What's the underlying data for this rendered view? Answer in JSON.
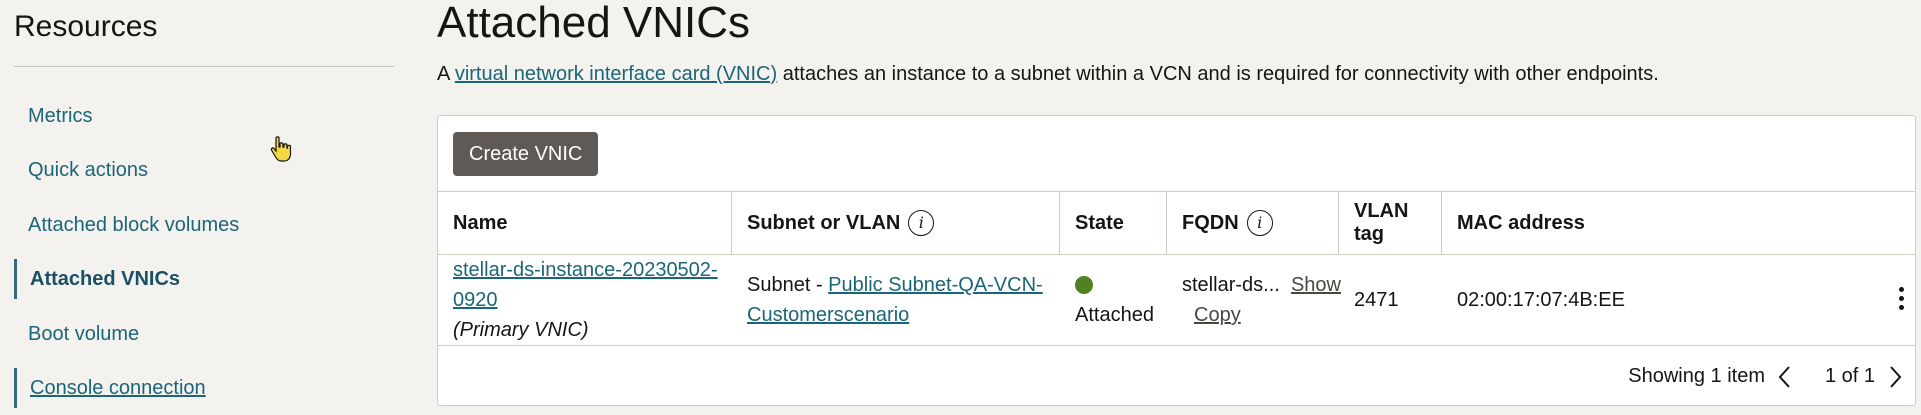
{
  "sidebar": {
    "title": "Resources",
    "items": [
      {
        "label": "Metrics"
      },
      {
        "label": "Quick actions"
      },
      {
        "label": "Attached block volumes"
      },
      {
        "label": "Attached VNICs"
      },
      {
        "label": "Boot volume"
      },
      {
        "label": "Console connection"
      }
    ]
  },
  "main": {
    "title": "Attached VNICs",
    "desc_prefix": "A",
    "desc_link": "virtual network interface card (VNIC)",
    "desc_suffix": "attaches an instance to a subnet within a VCN and is required for connectivity with other endpoints."
  },
  "table": {
    "create_button": "Create VNIC",
    "columns": [
      "Name",
      "Subnet or VLAN",
      "State",
      "FQDN",
      "VLAN tag",
      "MAC address"
    ],
    "rows": [
      {
        "name": "stellar-ds-instance-20230502-0920",
        "name_note": "(Primary VNIC)",
        "subnet_prefix": "Subnet -",
        "subnet_link_1": "Public Subnet-QA-VCN-",
        "subnet_link_2": "Customerscenario",
        "state": "Attached",
        "state_color": "#508223",
        "fqdn": "stellar-ds...",
        "fqdn_show": "Show",
        "fqdn_copy": "Copy",
        "vlan_tag": "2471",
        "mac": "02:00:17:07:4B:EE"
      }
    ],
    "footer": {
      "showing": "Showing 1 item",
      "pager": "1 of 1"
    }
  },
  "colors": {
    "accent": "#1b6578",
    "create_button_bg": "#5f5a55",
    "page_bg": "#f4f2ee"
  }
}
